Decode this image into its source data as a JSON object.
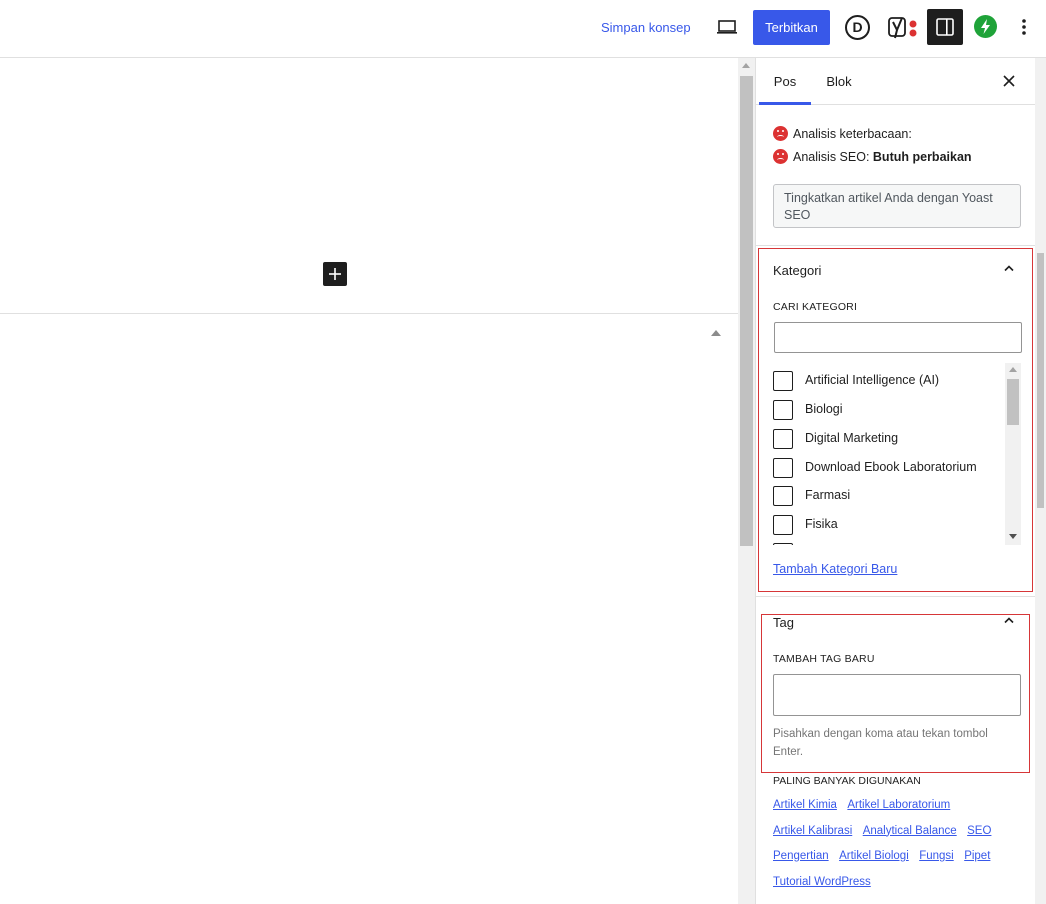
{
  "header": {
    "save_draft_label": "Simpan konsep",
    "publish_label": "Terbitkan",
    "divi_letter": "D",
    "icons": [
      "laptop-icon",
      "divi-icon",
      "yoast-icon",
      "sidebar-toggle-icon",
      "bolt-icon",
      "more-vertical-icon"
    ],
    "publish_color": "#3858e9"
  },
  "sidebar": {
    "tabs": [
      {
        "label": "Pos",
        "active": true
      },
      {
        "label": "Blok",
        "active": false
      }
    ],
    "seo": {
      "readability_label": "Analisis keterbacaan:",
      "seo_label": "Analisis SEO:",
      "seo_status": "Butuh perbaikan",
      "upgrade_button": "Tingkatkan artikel Anda dengan Yoast SEO",
      "status_color": "#dc3232"
    },
    "categories": {
      "title": "Kategori",
      "search_label": "CARI KATEGORI",
      "search_value": "",
      "items": [
        {
          "label": "Artificial Intelligence (AI)",
          "checked": false
        },
        {
          "label": "Biologi",
          "checked": false
        },
        {
          "label": "Digital Marketing",
          "checked": false
        },
        {
          "label": "Download Ebook Laboratorium",
          "checked": false
        },
        {
          "label": "Farmasi",
          "checked": false
        },
        {
          "label": "Fisika",
          "checked": false
        }
      ],
      "add_new_link": "Tambah Kategori Baru"
    },
    "tags": {
      "title": "Tag",
      "add_label": "TAMBAH TAG BARU",
      "input_value": "",
      "help_text": "Pisahkan dengan koma atau tekan tombol Enter.",
      "popular_label": "PALING BANYAK DIGUNAKAN",
      "popular": [
        "Artikel Kimia",
        "Artikel Laboratorium",
        "Artikel Kalibrasi",
        "Analytical Balance",
        "SEO",
        "Pengertian",
        "Artikel Biologi",
        "Fungsi",
        "Pipet",
        "Tutorial WordPress"
      ]
    }
  }
}
